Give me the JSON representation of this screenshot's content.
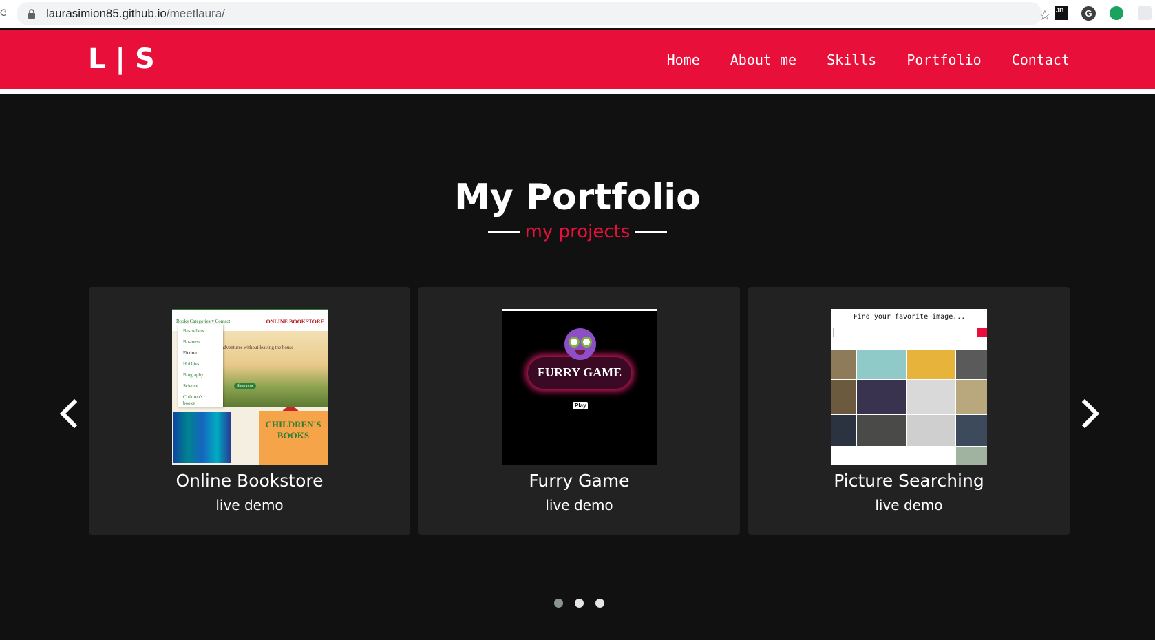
{
  "browser": {
    "url_host": "laurasimion85.github.io",
    "url_path": "/meetlaura/",
    "extensions": [
      "JB",
      "G"
    ]
  },
  "header": {
    "logo": "L | S",
    "nav": [
      "Home",
      "About me",
      "Skills",
      "Portfolio",
      "Contact"
    ]
  },
  "portfolio": {
    "title": "My Portfolio",
    "subtitle": "my projects",
    "projects": [
      {
        "title": "Online Bookstore",
        "link": "live demo",
        "thumb": {
          "menu": "Books Categories ▾   Contact",
          "brand": "ONLINE BOOKSTORE",
          "categories": [
            "Bestsellers",
            "Business",
            "Fiction",
            "Hobbies",
            "Biography",
            "Science",
            "Children's books"
          ],
          "hero_text": "adventures without leaving the house",
          "shop_button": "Shop now",
          "kids_banner": "CHILDREN'S BOOKS"
        }
      },
      {
        "title": "Furry Game",
        "link": "live demo",
        "thumb": {
          "game_title": "FURRY GAME",
          "play_button": "Play"
        }
      },
      {
        "title": "Picture Searching",
        "link": "live demo",
        "thumb": {
          "heading": "Find your favorite image..."
        }
      }
    ]
  },
  "carousel": {
    "slides": 3,
    "active_slide": 1
  },
  "colors": {
    "accent": "#e8103a",
    "background": "#111111",
    "card": "#222222"
  },
  "icons": [
    "reload-icon",
    "lock-icon",
    "star-icon",
    "chevron-left-icon",
    "chevron-right-icon"
  ]
}
